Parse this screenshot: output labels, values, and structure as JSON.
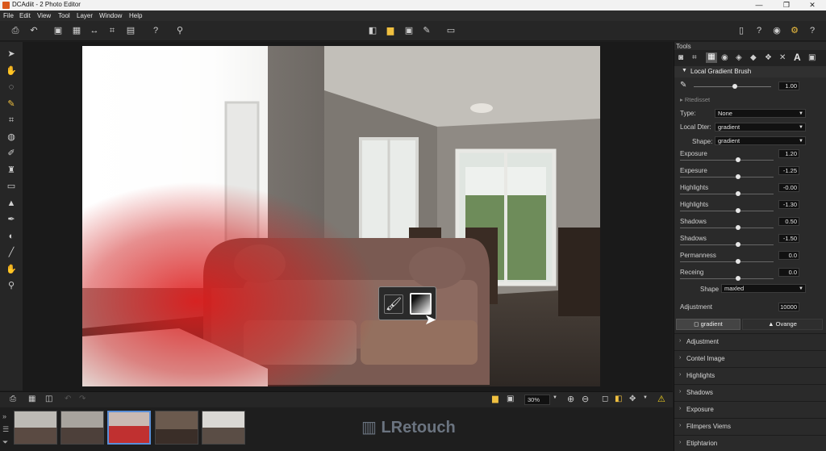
{
  "window": {
    "title": "DCAdiit - 2 Photo Editor"
  },
  "menu": [
    "File",
    "Edit",
    "View",
    "Tool",
    "Layer",
    "Window",
    "Help"
  ],
  "panel": {
    "header": "Tools",
    "section_title": "Local Gradient Brush",
    "brush_value": "1.00",
    "subheader": "Rtedisset",
    "type_label": "Type:",
    "type_value": "None",
    "local_label": "Local Dter:",
    "local_value": "gradient",
    "shape_label": "Shape:",
    "shape_value": "gradient",
    "sliders": [
      {
        "label": "Exposure",
        "value": "1.20",
        "pos": 0.62
      },
      {
        "label": "Expesure",
        "value": "-1.25",
        "pos": 0.62
      },
      {
        "label": "Highlights",
        "value": "-0.00",
        "pos": 0.62
      },
      {
        "label": "Highlights",
        "value": "-1.30",
        "pos": 0.62
      },
      {
        "label": "Shadows",
        "value": "0.50",
        "pos": 0.62
      },
      {
        "label": "Shadows",
        "value": "-1.50",
        "pos": 0.62
      },
      {
        "label": "Permanness",
        "value": "0.0",
        "pos": 0.62
      },
      {
        "label": "Receing",
        "value": "0.0",
        "pos": 0.62
      }
    ],
    "shape2_label": "Shape",
    "shape2_value": "maxled",
    "adjustment_label": "Adjustment",
    "adjustment_value": "10000",
    "tab_gradient": "gradient",
    "tab_orange": "Ovange",
    "sections": [
      "Adjustment",
      "Contel Image",
      "Highlights",
      "Shadows",
      "Exposure",
      "Filmpers Viems",
      "Etiphtarion"
    ]
  },
  "bottom": {
    "zoom": "30%",
    "watermark": "LRetouch"
  },
  "colors": {
    "accent": "#5a8fd8",
    "active_tool": "#f0c040",
    "warning": "#f0d020"
  },
  "icons": {
    "brush": "paintbrush-icon",
    "gradient": "gradient-square-icon",
    "cursor": "arrow-cursor-icon"
  }
}
